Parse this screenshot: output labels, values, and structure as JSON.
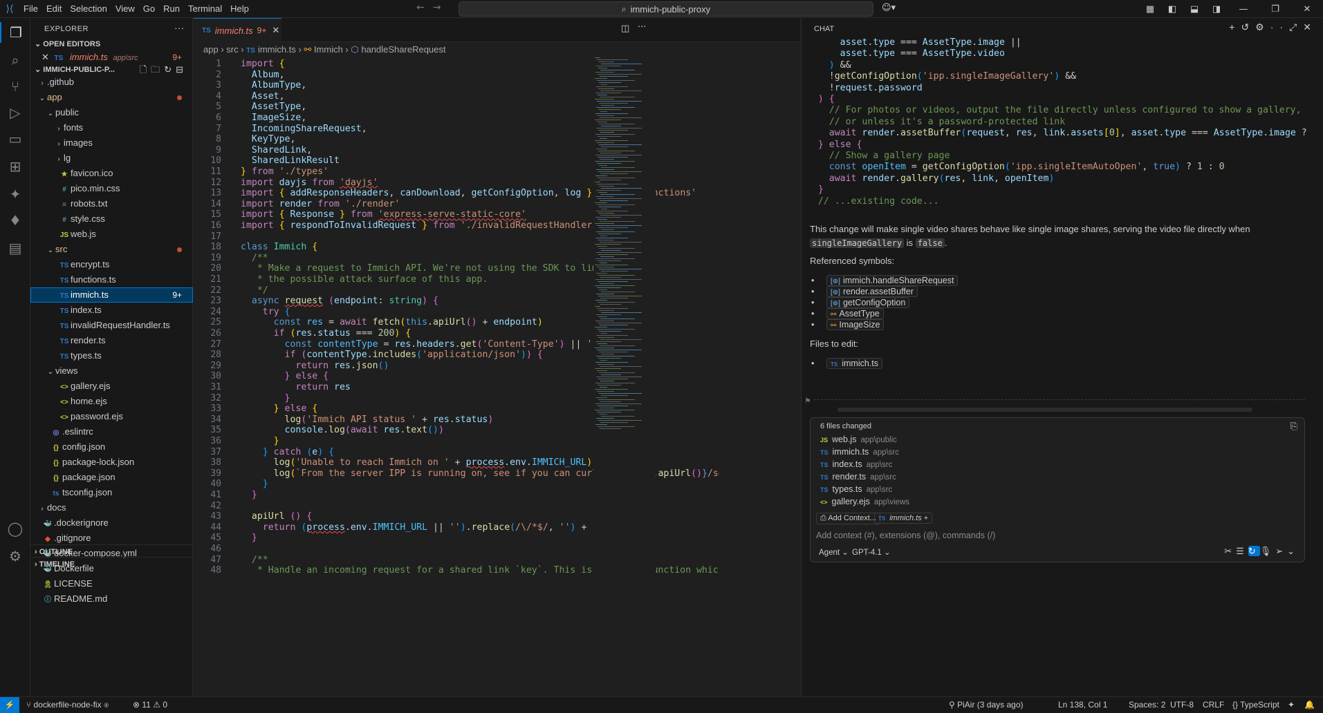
{
  "menu": [
    "File",
    "Edit",
    "Selection",
    "View",
    "Go",
    "Run",
    "Terminal",
    "Help"
  ],
  "command_center": "immich-public-proxy",
  "explorer": {
    "title": "EXPLORER",
    "open_editors_label": "OPEN EDITORS",
    "open_editor_file": "immich.ts",
    "open_editor_path": "app\\src",
    "open_editor_badge": "9+",
    "project_label": "IMMICH-PUBLIC-P...",
    "outline_label": "OUTLINE",
    "timeline_label": "TIMELINE",
    "tree": [
      {
        "name": ".github",
        "type": "folder",
        "indent": 1,
        "open": false
      },
      {
        "name": "app",
        "type": "folder",
        "indent": 1,
        "open": true,
        "mod": true
      },
      {
        "name": "public",
        "type": "folder",
        "indent": 2,
        "open": true
      },
      {
        "name": "fonts",
        "type": "folder",
        "indent": 3,
        "open": false
      },
      {
        "name": "images",
        "type": "folder",
        "indent": 3,
        "open": false
      },
      {
        "name": "lg",
        "type": "folder",
        "indent": 3,
        "open": false
      },
      {
        "name": "favicon.ico",
        "type": "ico",
        "indent": 3
      },
      {
        "name": "pico.min.css",
        "type": "css",
        "indent": 3
      },
      {
        "name": "robots.txt",
        "type": "txt",
        "indent": 3
      },
      {
        "name": "style.css",
        "type": "css",
        "indent": 3
      },
      {
        "name": "web.js",
        "type": "js",
        "indent": 3
      },
      {
        "name": "src",
        "type": "folder",
        "indent": 2,
        "open": true,
        "mod": true
      },
      {
        "name": "encrypt.ts",
        "type": "ts",
        "indent": 3
      },
      {
        "name": "functions.ts",
        "type": "ts",
        "indent": 3
      },
      {
        "name": "immich.ts",
        "type": "ts",
        "indent": 3,
        "selected": true,
        "badge": "9+"
      },
      {
        "name": "index.ts",
        "type": "ts",
        "indent": 3
      },
      {
        "name": "invalidRequestHandler.ts",
        "type": "ts",
        "indent": 3
      },
      {
        "name": "render.ts",
        "type": "ts",
        "indent": 3
      },
      {
        "name": "types.ts",
        "type": "ts",
        "indent": 3
      },
      {
        "name": "views",
        "type": "folder",
        "indent": 2,
        "open": true
      },
      {
        "name": "gallery.ejs",
        "type": "ejs",
        "indent": 3
      },
      {
        "name": "home.ejs",
        "type": "ejs",
        "indent": 3
      },
      {
        "name": "password.ejs",
        "type": "ejs",
        "indent": 3
      },
      {
        "name": ".eslintrc",
        "type": "eslint",
        "indent": 2
      },
      {
        "name": "config.json",
        "type": "json",
        "indent": 2
      },
      {
        "name": "package-lock.json",
        "type": "json",
        "indent": 2
      },
      {
        "name": "package.json",
        "type": "json",
        "indent": 2
      },
      {
        "name": "tsconfig.json",
        "type": "tsconfig",
        "indent": 2
      },
      {
        "name": "docs",
        "type": "folder",
        "indent": 1,
        "open": false
      },
      {
        "name": ".dockerignore",
        "type": "docker",
        "indent": 1
      },
      {
        "name": ".gitignore",
        "type": "git",
        "indent": 1
      },
      {
        "name": "docker-compose.yml",
        "type": "docker",
        "indent": 1
      },
      {
        "name": "Dockerfile",
        "type": "docker",
        "indent": 1
      },
      {
        "name": "LICENSE",
        "type": "license",
        "indent": 1
      },
      {
        "name": "README.md",
        "type": "md",
        "indent": 1
      }
    ]
  },
  "editor": {
    "tab_label": "immich.ts",
    "tab_badge": "9+",
    "breadcrumb": [
      "app",
      "src",
      "immich.ts",
      "Immich",
      "handleShareRequest"
    ],
    "lines": [
      "<span class=\"ctl\">import</span> <span class=\"br1\">{</span>",
      "  <span class=\"var\">Album</span>,",
      "  <span class=\"var\">AlbumType</span>,",
      "  <span class=\"var\">Asset</span>,",
      "  <span class=\"var\">AssetType</span>,",
      "  <span class=\"var\">ImageSize</span>,",
      "  <span class=\"var\">IncomingShareRequest</span>,",
      "  <span class=\"var\">KeyType</span>,",
      "  <span class=\"var\">SharedLink</span>,",
      "  <span class=\"var\">SharedLinkResult</span>",
      "<span class=\"br1\">}</span> <span class=\"ctl\">from</span> <span class=\"str\">'./types'</span>",
      "<span class=\"ctl\">import</span> <span class=\"var\">dayjs</span> <span class=\"ctl\">from</span> <span class=\"str squig\">'dayjs'</span>",
      "<span class=\"ctl\">import</span> <span class=\"br1\">{</span> <span class=\"var\">addResponseHeaders</span>, <span class=\"var\">canDownload</span>, <span class=\"var\">getConfigOption</span>, <span class=\"var\">log</span> <span class=\"br1\">}</span> <span class=\"ctl\">from</span> <span class=\"str\">'./functions'</span>",
      "<span class=\"ctl\">import</span> <span class=\"var\">render</span> <span class=\"ctl\">from</span> <span class=\"str\">'./render'</span>",
      "<span class=\"ctl\">import</span> <span class=\"br1\">{</span> <span class=\"var\">Response</span> <span class=\"br1\">}</span> <span class=\"ctl\">from</span> <span class=\"str squig\">'express-serve-static-core'</span>",
      "<span class=\"ctl\">import</span> <span class=\"br1\">{</span> <span class=\"var\">respondToInvalidRequest</span> <span class=\"br1\">}</span> <span class=\"ctl\">from</span> <span class=\"str\">'./invalidRequestHandler'</span>",
      "",
      "<span class=\"kw\">class</span> <span class=\"ty\">Immich</span> <span class=\"br1\">{</span>",
      "  <span class=\"com\">/**</span>",
      "<span class=\"com\">   * Make a request to Immich API. We're not using the SDK to limit</span>",
      "<span class=\"com\">   * the possible attack surface of this app.</span>",
      "<span class=\"com\">   */</span>",
      "  <span class=\"kw\">async</span> <span class=\"fn squig\">request</span> <span class=\"br2\">(</span><span class=\"var\">endpoint</span>: <span class=\"ty\">string</span><span class=\"br2\">)</span> <span class=\"br2\">{</span>",
      "    <span class=\"ctl\">try</span> <span class=\"br3\">{</span>",
      "      <span class=\"kw\">const</span> <span class=\"cst\">res</span> = <span class=\"ctl\">await</span> <span class=\"fn\">fetch</span><span class=\"br1\">(</span><span class=\"kw\">this</span>.<span class=\"fn\">apiUrl</span><span class=\"br2\">()</span> + <span class=\"var\">endpoint</span><span class=\"br1\">)</span>",
      "      <span class=\"ctl\">if</span> <span class=\"br1\">(</span><span class=\"var\">res</span>.<span class=\"var\">status</span> === <span class=\"num\">200</span><span class=\"br1\">)</span> <span class=\"br1\">{</span>",
      "        <span class=\"kw\">const</span> <span class=\"cst\">contentType</span> = <span class=\"var\">res</span>.<span class=\"var\">headers</span>.<span class=\"fn\">get</span><span class=\"br2\">(</span><span class=\"str\">'Content-Type'</span><span class=\"br2\">)</span> || <span class=\"str\">''</span>",
      "        <span class=\"ctl\">if</span> <span class=\"br2\">(</span><span class=\"var\">contentType</span>.<span class=\"fn\">includes</span><span class=\"br3\">(</span><span class=\"str\">'application/json'</span><span class=\"br3\">)</span><span class=\"br2\">)</span> <span class=\"br2\">{</span>",
      "          <span class=\"ctl\">return</span> <span class=\"var\">res</span>.<span class=\"fn\">json</span><span class=\"br3\">()</span>",
      "        <span class=\"br2\">}</span> <span class=\"ctl\">else</span> <span class=\"br2\">{</span>",
      "          <span class=\"ctl\">return</span> <span class=\"var\">res</span>",
      "        <span class=\"br2\">}</span>",
      "      <span class=\"br1\">}</span> <span class=\"ctl\">else</span> <span class=\"br1\">{</span>",
      "        <span class=\"fn\">log</span><span class=\"br2\">(</span><span class=\"str\">'Immich API status '</span> + <span class=\"var\">res</span>.<span class=\"var\">status</span><span class=\"br2\">)</span>",
      "        <span class=\"var\">console</span>.<span class=\"fn\">log</span><span class=\"br2\">(</span><span class=\"ctl\">await</span> <span class=\"var\">res</span>.<span class=\"fn\">text</span><span class=\"br3\">()</span><span class=\"br2\">)</span>",
      "      <span class=\"br1\">}</span>",
      "    <span class=\"br3\">}</span> <span class=\"ctl\">catch</span> <span class=\"br3\">(</span><span class=\"var\">e</span><span class=\"br3\">)</span> <span class=\"br3\">{</span>",
      "      <span class=\"fn\">log</span><span class=\"br1\">(</span><span class=\"str\">'Unable to reach Immich on '</span> + <span class=\"var squig\">process</span>.<span class=\"var\">env</span>.<span class=\"cst\">IMMICH_URL</span><span class=\"br1\">)</span>",
      "      <span class=\"fn\">log</span><span class=\"br1\">(</span><span class=\"str\">`From the server IPP is running on, see if you can curl to </span><span class=\"kw\">${</span><span class=\"kw\">this</span>.<span class=\"fn\">apiUrl</span><span class=\"br2\">()</span><span class=\"kw\">}</span><span class=\"str\">/serve</span>",
      "    <span class=\"br3\">}</span>",
      "  <span class=\"br2\">}</span>",
      "",
      "  <span class=\"fn\">apiUrl</span> <span class=\"br2\">()</span> <span class=\"br2\">{</span>",
      "    <span class=\"ctl\">return</span> <span class=\"br3\">(</span><span class=\"var squig\">process</span>.<span class=\"var\">env</span>.<span class=\"cst\">IMMICH_URL</span> || <span class=\"str\">''</span><span class=\"br3\">)</span>.<span class=\"fn\">replace</span><span class=\"br3\">(</span><span class=\"str\">/\\/*$/</span>, <span class=\"str\">''</span><span class=\"br3\">)</span> + <span class=\"str\">'/api'</span>",
      "  <span class=\"br2\">}</span>",
      "",
      "  <span class=\"com\">/**</span>",
      "<span class=\"com\">   * Handle an incoming request for a shared link `key`. This is the main function which</span>"
    ]
  },
  "chat": {
    "title": "CHAT",
    "code_lines": [
      "      <span class=\"var\">asset</span>.<span class=\"var\">type</span> === <span class=\"var\">AssetType</span>.<span class=\"var\">image</span> ||",
      "      <span class=\"var\">asset</span>.<span class=\"var\">type</span> === <span class=\"var\">AssetType</span>.<span class=\"var\">video</span>",
      "    <span class=\"br3\">)</span> &amp;&amp;",
      "    !<span class=\"fn\">getConfigOption</span><span class=\"br3\">(</span><span class=\"str\">'ipp.singleImageGallery'</span><span class=\"br3\">)</span> &amp;&amp;",
      "    !<span class=\"var\">request</span>.<span class=\"var\">password</span>",
      "  <span class=\"br2\">)</span> <span class=\"br2\">{</span>",
      "    <span class=\"com\">// For photos or videos, output the file directly unless configured to show a gallery,</span>",
      "    <span class=\"com\">// or unless it's a password-protected link</span>",
      "    <span class=\"ctl\">await</span> <span class=\"var\">render</span>.<span class=\"fn\">assetBuffer</span><span class=\"br3\">(</span><span class=\"var\">request</span>, <span class=\"var\">res</span>, <span class=\"var\">link</span>.<span class=\"var\">assets</span><span class=\"br1\">[</span><span class=\"num\">0</span><span class=\"br1\">]</span>, <span class=\"var\">asset</span>.<span class=\"var\">type</span> === <span class=\"var\">AssetType</span>.<span class=\"var\">image</span> ? <span class=\"var\">Ima</span>",
      "  <span class=\"br2\">}</span> <span class=\"ctl\">else</span> <span class=\"br2\">{</span>",
      "    <span class=\"com\">// Show a gallery page</span>",
      "    <span class=\"kw\">const</span> <span class=\"cst\">openItem</span> = <span class=\"fn\">getConfigOption</span><span class=\"br3\">(</span><span class=\"str\">'ipp.singleItemAutoOpen'</span>, <span class=\"kw\">true</span><span class=\"br3\">)</span> ? <span class=\"num\">1</span> : <span class=\"num\">0</span>",
      "    <span class=\"ctl\">await</span> <span class=\"var\">render</span>.<span class=\"fn\">gallery</span><span class=\"br3\">(</span><span class=\"var\">res</span>, <span class=\"var\">link</span>, <span class=\"var\">openItem</span><span class=\"br3\">)</span>",
      "  <span class=\"br2\">}</span>",
      "  <span class=\"com\">// ...existing code...</span>"
    ],
    "explain_1": "This change will make single video shares behave like single image shares, serving the video file directly when",
    "explain_code_1": "singleImageGallery",
    "explain_is": "is",
    "explain_code_2": "false",
    "explain_end": ".",
    "referenced_label": "Referenced symbols:",
    "referenced": [
      {
        "label": "immich.handleShareRequest",
        "kind": "sym"
      },
      {
        "label": "render.assetBuffer",
        "kind": "sym"
      },
      {
        "label": "getConfigOption",
        "kind": "sym"
      },
      {
        "label": "AssetType",
        "kind": "cls"
      },
      {
        "label": "ImageSize",
        "kind": "cls"
      }
    ],
    "files_to_edit_label": "Files to edit:",
    "files_to_edit": [
      "immich.ts"
    ],
    "changes_header": "6 files changed",
    "changed_files": [
      {
        "name": "web.js",
        "path": "app\\public",
        "type": "JS"
      },
      {
        "name": "immich.ts",
        "path": "app\\src",
        "type": "TS"
      },
      {
        "name": "index.ts",
        "path": "app\\src",
        "type": "TS"
      },
      {
        "name": "render.ts",
        "path": "app\\src",
        "type": "TS"
      },
      {
        "name": "types.ts",
        "path": "app\\src",
        "type": "TS"
      },
      {
        "name": "gallery.ejs",
        "path": "app\\views",
        "type": "EJS"
      }
    ],
    "add_context_label": "Add Context...",
    "context_file": "immich.ts",
    "input_placeholder": "Add context (#), extensions (@), commands (/)",
    "mode_label": "Agent",
    "model_label": "GPT-4.1"
  },
  "status": {
    "branch": "dockerfile-node-fix",
    "errors": "11",
    "warnings": "0",
    "blame": "PiAir (3 days ago)",
    "position": "Ln 138, Col 1",
    "spaces": "Spaces: 2",
    "encoding": "UTF-8",
    "eol": "CRLF",
    "language": "TypeScript"
  }
}
